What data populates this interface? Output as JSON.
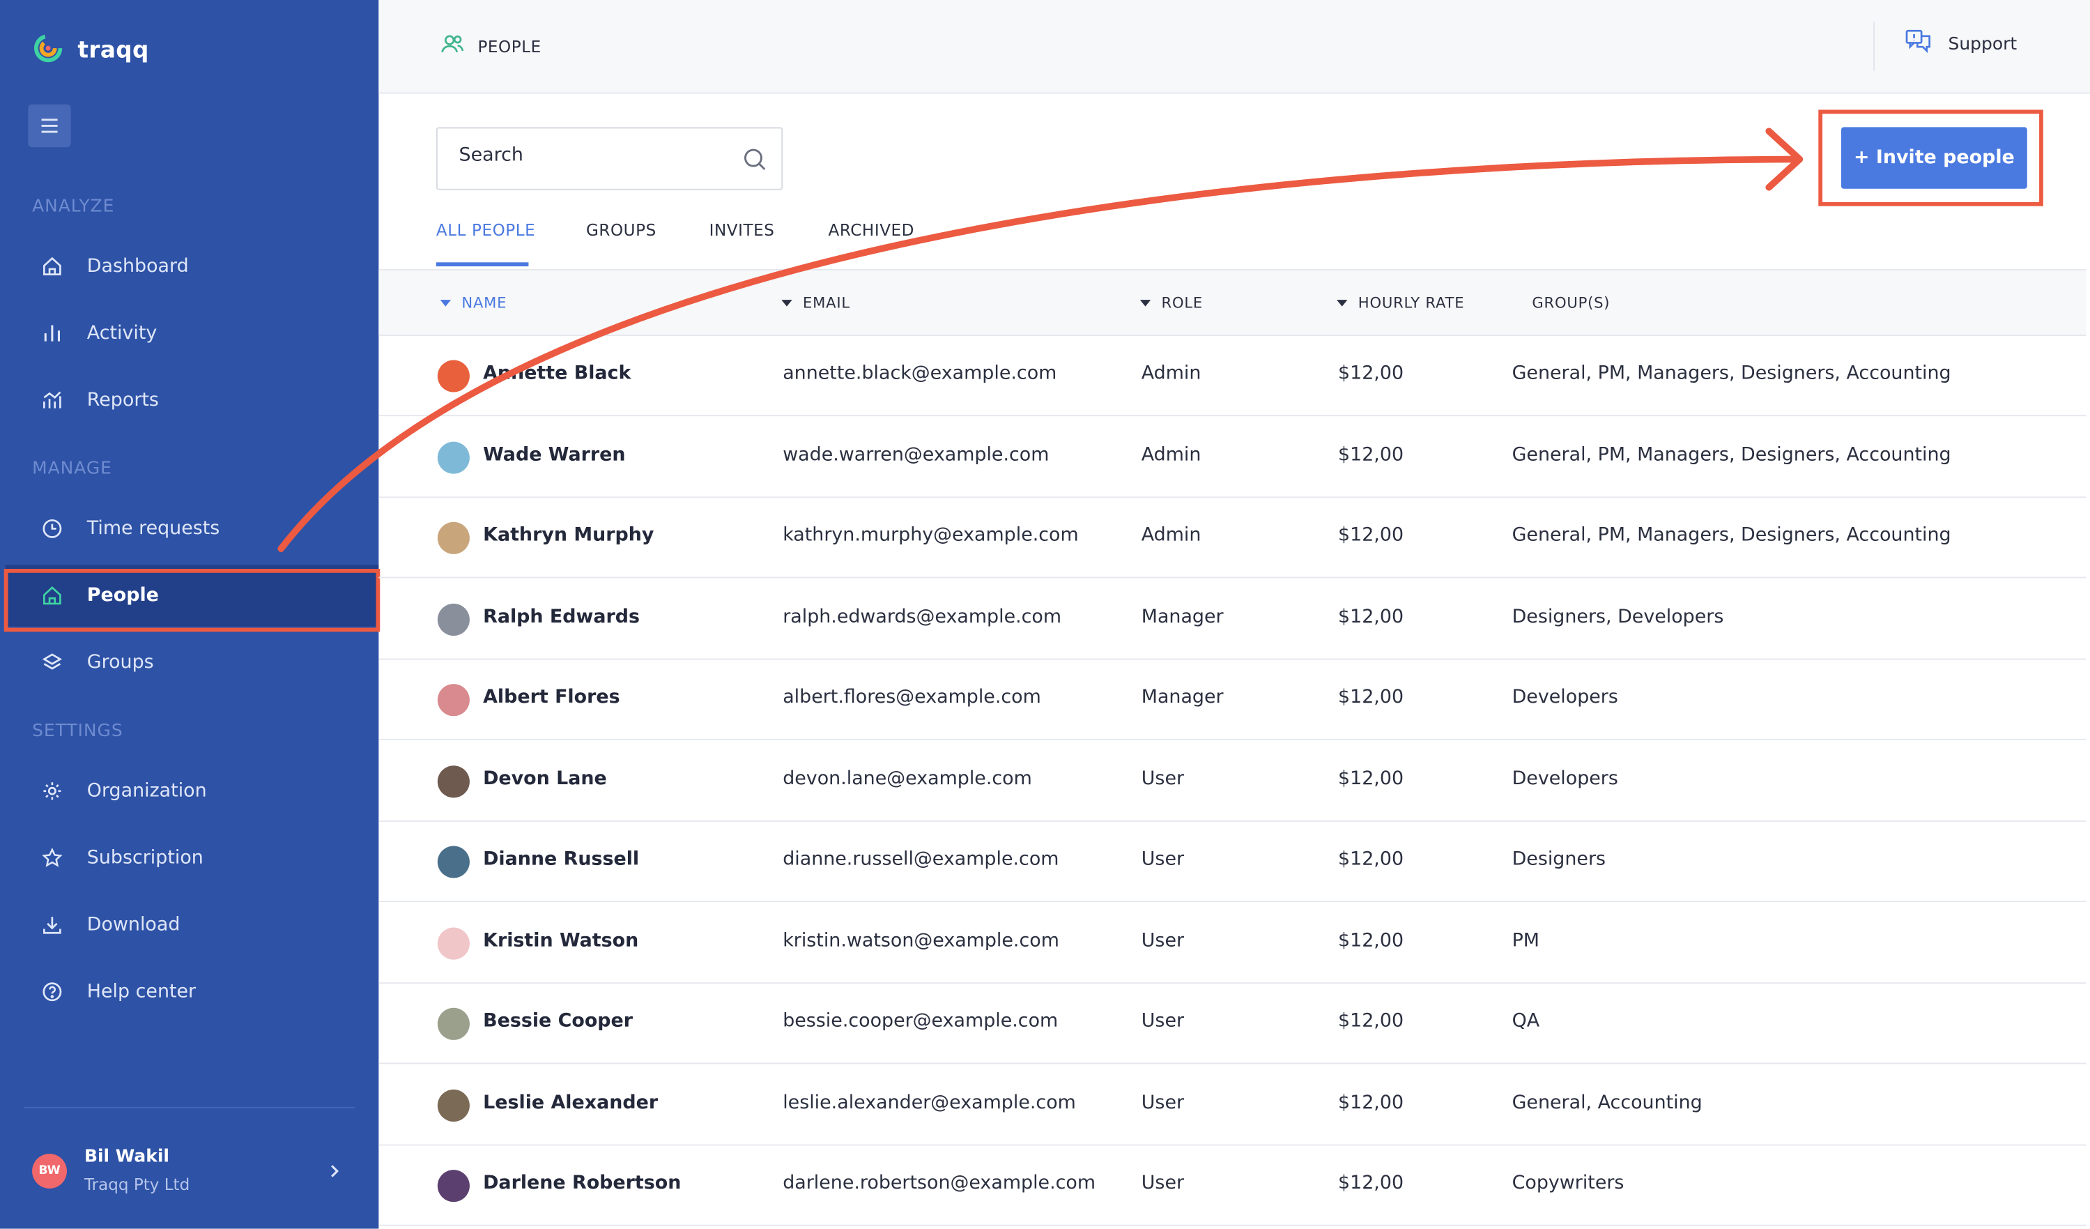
{
  "brand": {
    "name": "traqq"
  },
  "sidebar": {
    "sections": [
      {
        "title": "ANALYZE",
        "items": [
          {
            "label": "Dashboard",
            "icon": "home-icon"
          },
          {
            "label": "Activity",
            "icon": "bar-chart-icon"
          },
          {
            "label": "Reports",
            "icon": "reports-icon"
          }
        ]
      },
      {
        "title": "MANAGE",
        "items": [
          {
            "label": "Time requests",
            "icon": "clock-icon"
          },
          {
            "label": "People",
            "icon": "home-icon",
            "active": true
          },
          {
            "label": "Groups",
            "icon": "layers-icon"
          }
        ]
      },
      {
        "title": "SETTINGS",
        "items": [
          {
            "label": "Organization",
            "icon": "gear-icon"
          },
          {
            "label": "Subscription",
            "icon": "star-icon"
          },
          {
            "label": "Download",
            "icon": "download-icon"
          },
          {
            "label": "Help center",
            "icon": "help-icon"
          }
        ]
      }
    ],
    "user": {
      "initials": "BW",
      "name": "Bil Wakil",
      "org": "Traqq Pty Ltd"
    }
  },
  "header": {
    "title": "PEOPLE",
    "support_label": "Support"
  },
  "search": {
    "placeholder": "Search"
  },
  "invite_button": "+ Invite people",
  "tabs": [
    {
      "label": "ALL PEOPLE",
      "active": true
    },
    {
      "label": "GROUPS"
    },
    {
      "label": "INVITES"
    },
    {
      "label": "ARCHIVED"
    }
  ],
  "table": {
    "columns": [
      "NAME",
      "EMAIL",
      "ROLE",
      "HOURLY RATE",
      "GROUP(S)"
    ],
    "rows": [
      {
        "name": "Annette Black",
        "email": "annette.black@example.com",
        "role": "Admin",
        "rate": "$12,00",
        "groups": "General, PM, Managers, Designers, Accounting"
      },
      {
        "name": "Wade Warren",
        "email": "wade.warren@example.com",
        "role": "Admin",
        "rate": "$12,00",
        "groups": "General, PM, Managers, Designers, Accounting"
      },
      {
        "name": "Kathryn Murphy",
        "email": "kathryn.murphy@example.com",
        "role": "Admin",
        "rate": "$12,00",
        "groups": "General, PM, Managers, Designers, Accounting"
      },
      {
        "name": "Ralph Edwards",
        "email": "ralph.edwards@example.com",
        "role": "Manager",
        "rate": "$12,00",
        "groups": "Designers, Developers"
      },
      {
        "name": "Albert Flores",
        "email": "albert.flores@example.com",
        "role": "Manager",
        "rate": "$12,00",
        "groups": "Developers"
      },
      {
        "name": "Devon Lane",
        "email": "devon.lane@example.com",
        "role": "User",
        "rate": "$12,00",
        "groups": "Developers"
      },
      {
        "name": "Dianne Russell",
        "email": "dianne.russell@example.com",
        "role": "User",
        "rate": "$12,00",
        "groups": "Designers"
      },
      {
        "name": "Kristin Watson",
        "email": "kristin.watson@example.com",
        "role": "User",
        "rate": "$12,00",
        "groups": "PM"
      },
      {
        "name": "Bessie Cooper",
        "email": "bessie.cooper@example.com",
        "role": "User",
        "rate": "$12,00",
        "groups": "QA"
      },
      {
        "name": "Leslie Alexander",
        "email": "leslie.alexander@example.com",
        "role": "User",
        "rate": "$12,00",
        "groups": "General, Accounting"
      },
      {
        "name": "Darlene Robertson",
        "email": "darlene.robertson@example.com",
        "role": "User",
        "rate": "$12,00",
        "groups": "Copywriters"
      }
    ]
  },
  "colors": {
    "sidebar": "#2d52a6",
    "accent": "#4a79e0",
    "annotation": "#ec5a41",
    "active_icon": "#3fd3a3"
  }
}
